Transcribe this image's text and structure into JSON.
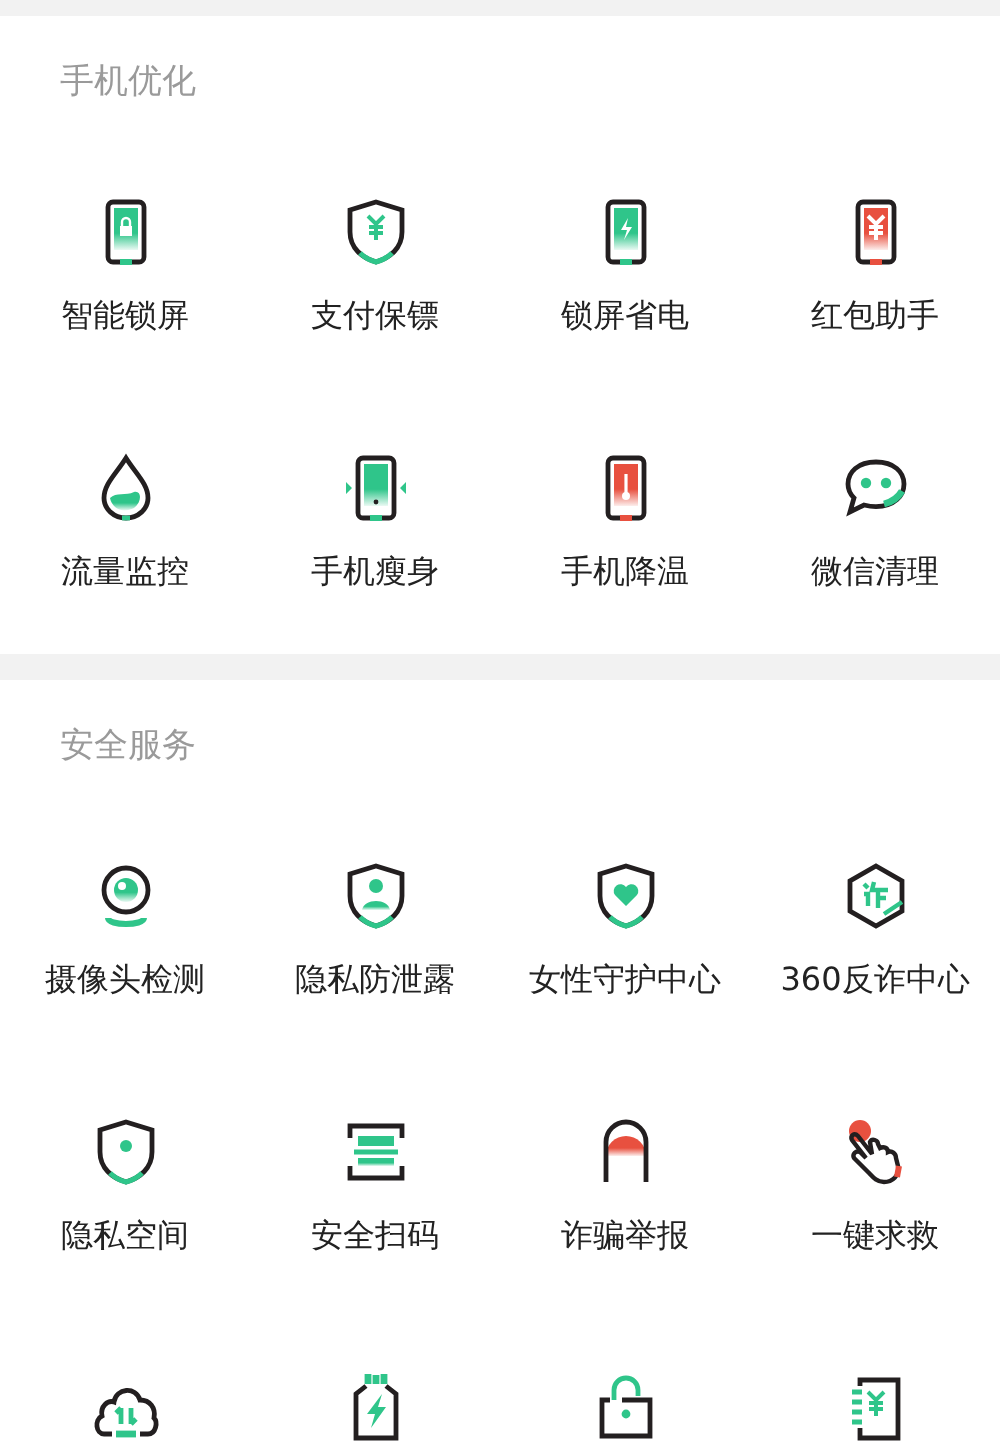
{
  "sections": [
    {
      "title": "手机优化",
      "items": [
        {
          "label": "智能锁屏",
          "kind": "lockphone",
          "color": "#2fc58a"
        },
        {
          "label": "支付保镖",
          "kind": "yenshield",
          "color": "#2fc58a"
        },
        {
          "label": "锁屏省电",
          "kind": "boltphone",
          "color": "#2fc58a"
        },
        {
          "label": "红包助手",
          "kind": "yenphone",
          "color": "#e8503f"
        },
        {
          "label": "流量监控",
          "kind": "drop",
          "color": "#2fc58a"
        },
        {
          "label": "手机瘦身",
          "kind": "slimphone",
          "color": "#2fc58a"
        },
        {
          "label": "手机降温",
          "kind": "thermophone",
          "color": "#e8503f"
        },
        {
          "label": "微信清理",
          "kind": "chat",
          "color": "#2fc58a"
        }
      ]
    },
    {
      "title": "安全服务",
      "items": [
        {
          "label": "摄像头检测",
          "kind": "camera",
          "color": "#2fc58a"
        },
        {
          "label": "隐私防泄露",
          "kind": "personshield",
          "color": "#2fc58a"
        },
        {
          "label": "女性守护中心",
          "kind": "heartshield",
          "color": "#2fc58a"
        },
        {
          "label": "360反诈中心",
          "kind": "hexagon",
          "color": "#2fc58a"
        },
        {
          "label": "隐私空间",
          "kind": "pinshield",
          "color": "#2fc58a"
        },
        {
          "label": "安全扫码",
          "kind": "scan",
          "color": "#2fc58a"
        },
        {
          "label": "诈骗举报",
          "kind": "finger",
          "color": "#e8503f"
        },
        {
          "label": "一键求救",
          "kind": "hand",
          "color": "#e8503f"
        },
        {
          "kind": "cloud",
          "color": "#2fc58a"
        },
        {
          "kind": "battery",
          "color": "#2fc58a"
        },
        {
          "kind": "unlock",
          "color": "#2fc58a"
        },
        {
          "kind": "notebook",
          "color": "#2fc58a"
        }
      ]
    }
  ]
}
